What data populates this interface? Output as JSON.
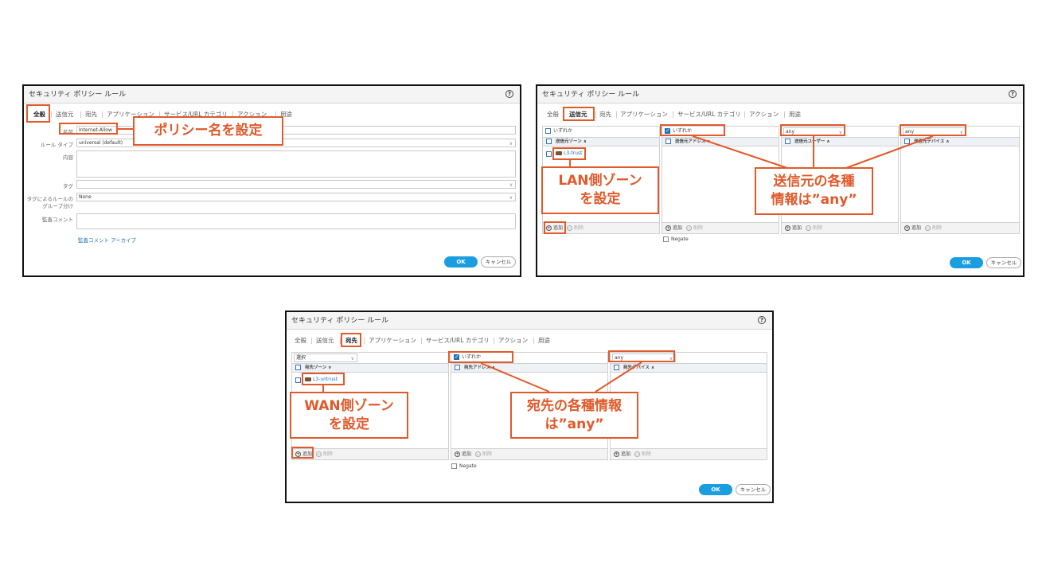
{
  "dialog_title": "セキュリティ ポリシー ルール",
  "help_icon": "?",
  "tabs": {
    "general": "全般",
    "source": "送信元",
    "destination": "宛先",
    "application": "アプリケーション",
    "service": "サービス/URL カテゴリ",
    "action": "アクション",
    "usage": "用途"
  },
  "general": {
    "name_label": "名前",
    "name_value": "Internet-Allow",
    "rule_type_label": "ルール タイプ",
    "rule_type_value": "universal (default)",
    "description_label": "内容",
    "tag_label": "タグ",
    "group_label_1": "タグによるルールの",
    "group_label_2": "グループ分け",
    "group_value": "None",
    "audit_label": "監査コメント",
    "audit_archive_link": "監査コメント アーカイブ"
  },
  "source": {
    "any_label": "いずれか",
    "col_zone_header": "送信元ゾーン ∧",
    "zone_item": "L3-trust",
    "col_address_header": "送信元アドレス ∧",
    "user_value": "any",
    "col_user_header": "送信元ユーザー ∧",
    "device_value": "any",
    "col_device_header": "送信元デバイス ∧",
    "negate_label": "Negate"
  },
  "destination": {
    "select_value": "選択",
    "any_label": "いずれか",
    "col_zone_header": "宛先ゾーン ∨",
    "zone_item": "L3-untrust",
    "col_address_header": "宛先アドレス ∧",
    "device_value": "any",
    "col_device_header": "宛先デバイス ∧",
    "negate_label": "Negate"
  },
  "footer": {
    "add": "追加",
    "delete": "削除"
  },
  "buttons": {
    "ok": "OK",
    "cancel": "キャンセル"
  },
  "callouts": {
    "policy_name": "ポリシー名を設定",
    "lan_zone_1": "LAN側ゾーン",
    "lan_zone_2": "を設定",
    "source_any_1": "送信元の各種",
    "source_any_2": "情報は”any”",
    "wan_zone_1": "WAN側ゾーン",
    "wan_zone_2": "を設定",
    "dest_any_1": "宛先の各種情報",
    "dest_any_2": "は”any”"
  },
  "colors": {
    "accent": "#e05a2b",
    "ok_button": "#1a9ee0",
    "link": "#1d6fb8"
  }
}
